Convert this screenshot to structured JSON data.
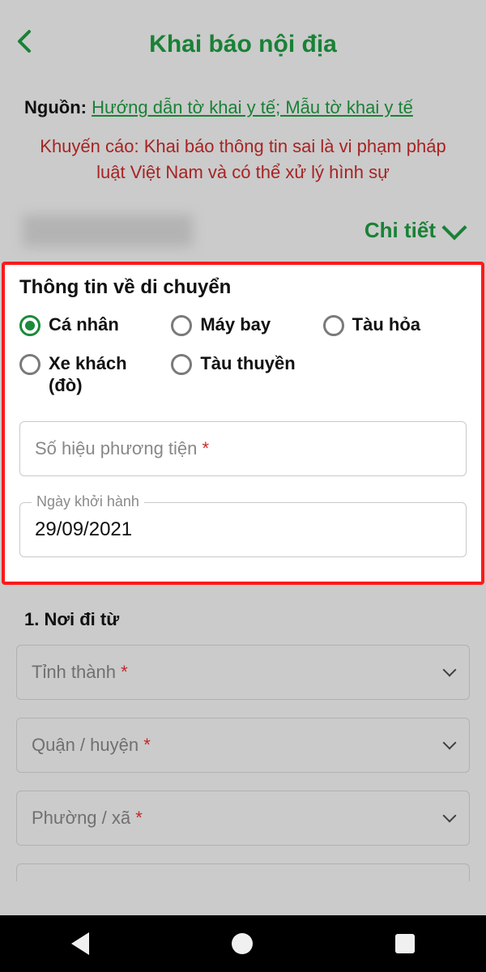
{
  "header": {
    "title": "Khai báo nội địa"
  },
  "source": {
    "label": "Nguồn:",
    "link_text": "Hướng dẫn tờ khai y tế; Mẫu tờ khai y tế"
  },
  "warning": "Khuyến cáo: Khai báo thông tin sai là vi phạm pháp luật Việt Nam và có thể xử lý hình sự",
  "usercard": {
    "detail_label": "Chi tiết"
  },
  "travel": {
    "section_title": "Thông tin về di chuyển",
    "options": {
      "personal": "Cá nhân",
      "plane": "Máy bay",
      "train": "Tàu hỏa",
      "bus": "Xe khách (đò)",
      "boat": "Tàu thuyền"
    },
    "selected": "personal",
    "vehicle_number_placeholder": "Số hiệu phương tiện",
    "vehicle_number_value": "",
    "depart_date_label": "Ngày khởi hành",
    "depart_date_value": "29/09/2021"
  },
  "from": {
    "section_title": "1. Nơi đi từ",
    "province_label": "Tỉnh thành",
    "district_label": "Quận / huyện",
    "ward_label": "Phường / xã"
  }
}
